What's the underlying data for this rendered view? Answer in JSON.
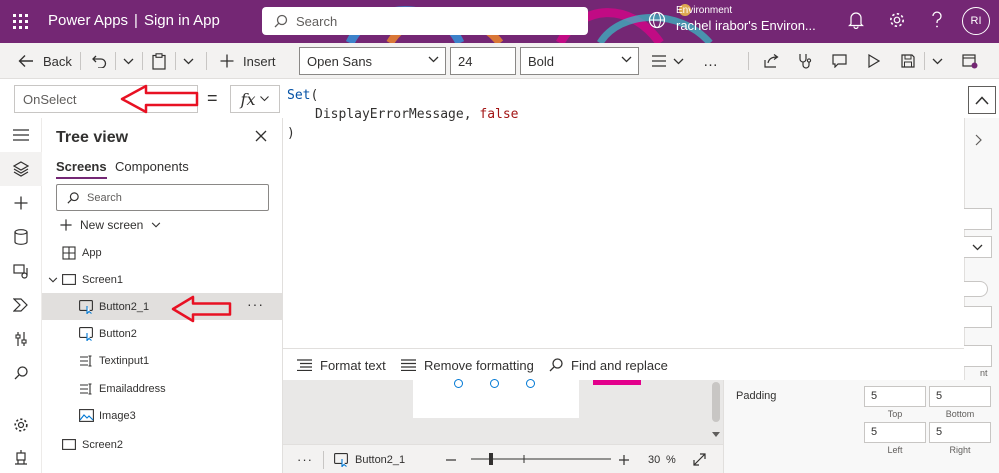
{
  "header": {
    "app_name": "Power Apps",
    "separator": "|",
    "page_name": "Sign in App",
    "search_placeholder": "Search",
    "environment_label": "Environment",
    "environment_name": "rachel irabor's Environ...",
    "avatar_initials": "RI"
  },
  "command_bar": {
    "back_label": "Back",
    "insert_label": "Insert",
    "font_family": "Open Sans",
    "font_size": "24",
    "font_weight": "Bold",
    "more_label": "…"
  },
  "formula_bar": {
    "property": "OnSelect",
    "equals": "=",
    "fx_label": "fx"
  },
  "code": {
    "line1_keyword": "Set",
    "line1_paren": "(",
    "line2_identifier": "DisplayErrorMessage,",
    "line2_value": "false",
    "line3_paren": ")"
  },
  "code_toolbar": {
    "format_text": "Format text",
    "remove_formatting": "Remove formatting",
    "find_replace": "Find and replace"
  },
  "tree_view": {
    "title": "Tree view",
    "tabs": [
      "Screens",
      "Components"
    ],
    "search_placeholder": "Search",
    "new_screen": "New screen",
    "items": [
      {
        "label": "App",
        "icon": "app-icon"
      },
      {
        "label": "Screen1",
        "icon": "screen-icon"
      },
      {
        "label": "Button2_1",
        "icon": "button-icon"
      },
      {
        "label": "Button2",
        "icon": "button-icon"
      },
      {
        "label": "Textinput1",
        "icon": "text-input-icon"
      },
      {
        "label": "Emailaddress",
        "icon": "text-input-icon"
      },
      {
        "label": "Image3",
        "icon": "image-icon"
      },
      {
        "label": "Screen2",
        "icon": "screen-icon"
      }
    ],
    "item_more": "···"
  },
  "status_bar": {
    "more": "···",
    "selected_control": "Button2_1",
    "zoom_value": "30",
    "zoom_unit": "%"
  },
  "properties": {
    "padding_label": "Padding",
    "truncated_label": "nt",
    "padding_top": "5",
    "padding_bottom": "5",
    "padding_left": "5",
    "padding_right": "5",
    "top_caption": "Top",
    "bottom_caption": "Bottom",
    "left_caption": "Left",
    "right_caption": "Right"
  },
  "colors": {
    "brand": "#742774",
    "selection_accent": "#e3008c",
    "annotation_arrow": "#e81123",
    "code_keyword": "#0451a5",
    "code_boolean": "#a31515"
  }
}
